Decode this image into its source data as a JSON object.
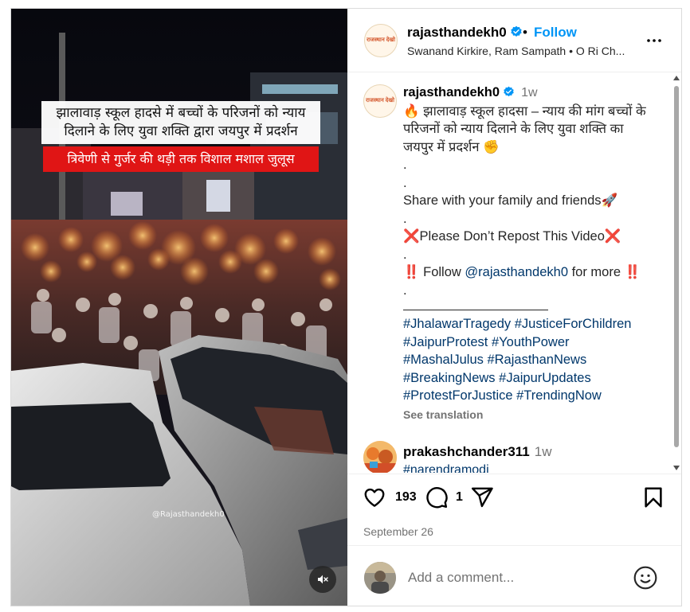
{
  "post": {
    "username": "rajasthandekh0",
    "follow_label": "Follow",
    "dot": "•",
    "audio_line": "Swanand Kirkire, Ram Sampath • O Ri Ch...",
    "avatar_logo_text": "राजस्थान देखो"
  },
  "media": {
    "overlay_line1": "झालावाड़ स्कूल हादसे में बच्चों के परिजनों को न्याय दिलाने के लिए युवा शक्ति द्वारा जयपुर में प्रदर्शन",
    "overlay_line2": "त्रिवेणी से गुर्जर की थड़ी तक विशाल मशाल जुलूस",
    "watermark": "@Rajasthandekh0"
  },
  "caption": {
    "username": "rajasthandekh0",
    "time": "1w",
    "line1": "🔥 झालावाड़ स्कूल हादसा – न्याय की मांग बच्चों के परिजनों को न्याय दिलाने के लिए युवा शक्ति का जयपुर में प्रदर्शन ✊",
    "dot1": ".",
    "dot2": ".",
    "share": "Share with your family and friends🚀",
    "dot3": ".",
    "no_repost": "❌Please Don’t Repost This Video❌",
    "dot4": ".",
    "follow_prefix": "‼️ Follow ",
    "follow_mention": "@rajasthandekh0",
    "follow_suffix": " for more ‼️",
    "dot5": ".",
    "hashtags_1": "#JhalawarTragedy #JusticeForChildren",
    "hashtags_2": "#JaipurProtest #YouthPower",
    "hashtags_3": "#MashalJulus #RajasthanNews",
    "hashtags_4": "#BreakingNews #JaipurUpdates",
    "hashtags_5": "#ProtestForJustice #TrendingNow",
    "see_translation": "See translation"
  },
  "first_comment": {
    "username": "prakashchander311",
    "time": "1w",
    "text": "#narendramodi"
  },
  "actions": {
    "like_count": "193",
    "comment_count": "1",
    "date": "September 26"
  },
  "comment_box": {
    "placeholder": "Add a comment..."
  },
  "colors": {
    "link_blue": "#0095f6",
    "hashtag_blue": "#00376b",
    "verified_blue": "#0095f6",
    "overlay_red": "#e01515",
    "muted_gray": "#737373"
  },
  "icons": [
    "verified-badge-icon",
    "more-options-icon",
    "heart-icon",
    "comment-icon",
    "share-icon",
    "bookmark-icon",
    "emoji-icon",
    "mute-icon"
  ]
}
